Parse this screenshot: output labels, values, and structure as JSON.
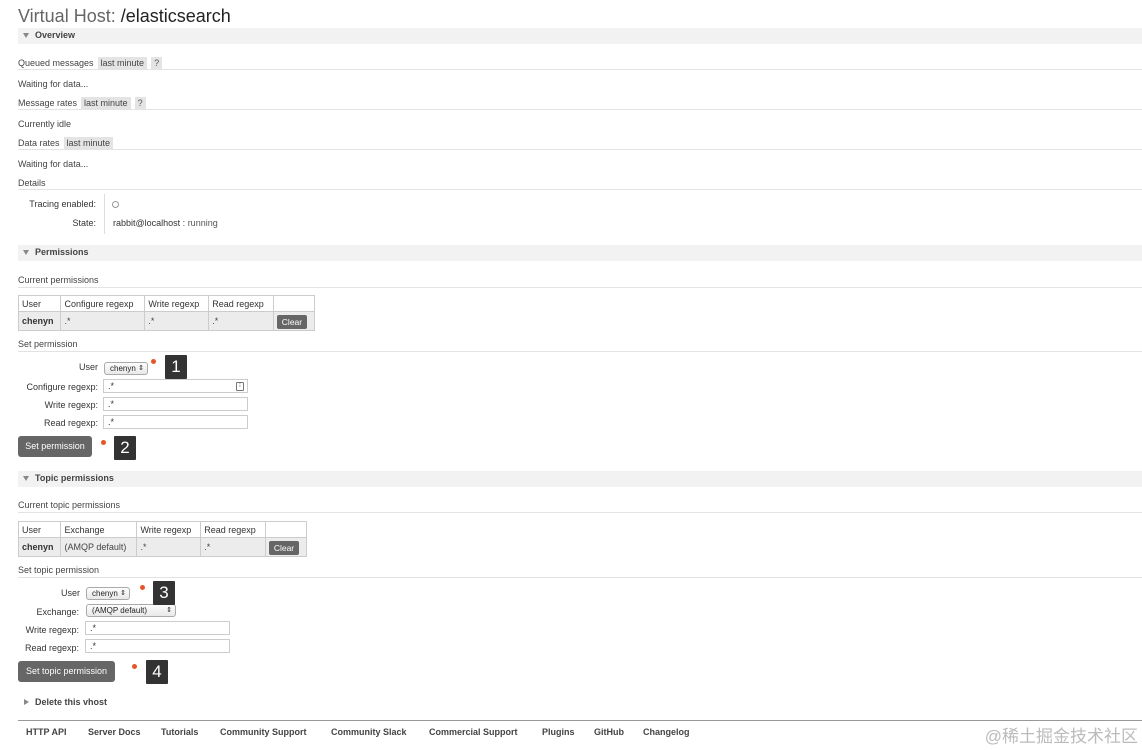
{
  "title": {
    "prefix": "Virtual Host:",
    "name": "/elasticsearch"
  },
  "overview": {
    "heading": "Overview",
    "queued": {
      "label": "Queued messages",
      "range": "last minute",
      "help": "?",
      "status": "Waiting for data..."
    },
    "rates": {
      "label": "Message rates",
      "range": "last minute",
      "help": "?",
      "status": "Currently idle"
    },
    "data": {
      "label": "Data rates",
      "range": "last minute",
      "status": "Waiting for data..."
    },
    "details": {
      "label": "Details",
      "tracing_label": "Tracing enabled:",
      "tracing_value": "○",
      "state_label": "State:",
      "state_node": "rabbit@localhost",
      "state_sep": " : ",
      "state_value": "running"
    }
  },
  "permissions": {
    "heading": "Permissions",
    "current_label": "Current permissions",
    "columns": [
      "User",
      "Configure regexp",
      "Write regexp",
      "Read regexp"
    ],
    "rows": [
      {
        "user": "chenyn",
        "configure": ".*",
        "write": ".*",
        "read": ".*",
        "action": "Clear"
      }
    ],
    "set_label": "Set permission",
    "form": {
      "user_label": "User",
      "user_value": "chenyn",
      "configure_label": "Configure regexp:",
      "configure_value": ".*",
      "write_label": "Write regexp:",
      "write_value": ".*",
      "read_label": "Read regexp:",
      "read_value": ".*",
      "submit": "Set permission"
    }
  },
  "topic_permissions": {
    "heading": "Topic permissions",
    "current_label": "Current topic permissions",
    "columns": [
      "User",
      "Exchange",
      "Write regexp",
      "Read regexp"
    ],
    "rows": [
      {
        "user": "chenyn",
        "exchange": "(AMQP default)",
        "write": ".*",
        "read": ".*",
        "action": "Clear"
      }
    ],
    "set_label": "Set topic permission",
    "form": {
      "user_label": "User",
      "user_value": "chenyn",
      "exchange_label": "Exchange:",
      "exchange_value": "(AMQP default)",
      "write_label": "Write regexp:",
      "write_value": ".*",
      "read_label": "Read regexp:",
      "read_value": ".*",
      "submit": "Set topic permission"
    }
  },
  "delete": {
    "heading": "Delete this vhost"
  },
  "annotations": [
    "1",
    "2",
    "3",
    "4"
  ],
  "footer": {
    "links": [
      "HTTP API",
      "Server Docs",
      "Tutorials",
      "Community Support",
      "Community Slack",
      "Commercial Support",
      "Plugins",
      "GitHub",
      "Changelog"
    ]
  },
  "watermark": "@稀土掘金技术社区",
  "colors": {
    "annotation_dot": "#e8542a",
    "button": "#666666",
    "annotation_box": "#333333"
  }
}
